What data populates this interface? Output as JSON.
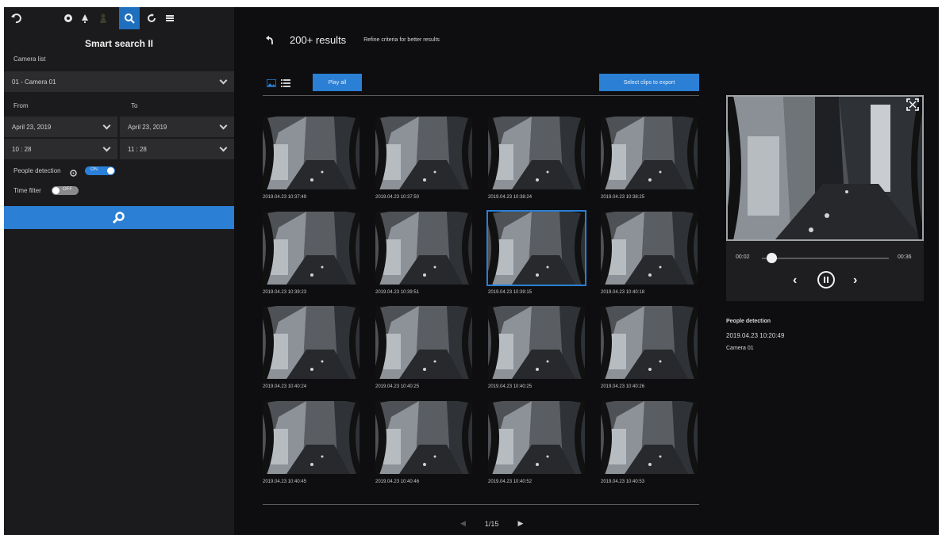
{
  "app": {
    "title": "Smart search II",
    "toolbar_icons": [
      "back-icon",
      "live-icon",
      "alert-icon",
      "person-icon",
      "smart-search-icon",
      "playback-icon",
      "menu-icon"
    ]
  },
  "sidebar": {
    "camera_list_label": "Camera list",
    "camera_value": "01 - Camera 01",
    "from_label": "From",
    "to_label": "To",
    "from_date": "April 23, 2019",
    "to_date": "April 23, 2019",
    "from_time": "10 : 28",
    "to_time": "11 : 28",
    "people_detection_label": "People detection",
    "people_detection_state": "ON",
    "time_filter_label": "Time filter",
    "time_filter_state": "OFF"
  },
  "results": {
    "count_text": "200+ results",
    "refine_text": "Refine criteria for better results",
    "play_all": "Play all",
    "export_label": "Select clips to export",
    "selected_index": 6,
    "thumbnails": [
      "2019.04.23 10:37:49",
      "2019.04.23 10:37:50",
      "2019.04.23 10:38:24",
      "2019.04.23 10:38:25",
      "2019.04.23 10:39:23",
      "2019.04.23 10:39:51",
      "2019.04.23 10:39:15",
      "2019.04.23 10:40:18",
      "2019.04.23 10:40:24",
      "2019.04.23 10:40:25",
      "2019.04.23 10:40:25",
      "2019.04.23 10:40:26",
      "2019.04.23 10:40:45",
      "2019.04.23 10:40:46",
      "2019.04.23 10:40:52",
      "2019.04.23 10:40:53"
    ],
    "page": "1/15"
  },
  "preview": {
    "time_current": "00:02",
    "time_total": "00:36",
    "progress": 0.05,
    "event_type": "People detection",
    "event_time": "2019.04.23 10:20:49",
    "event_camera": "Camera 01"
  }
}
